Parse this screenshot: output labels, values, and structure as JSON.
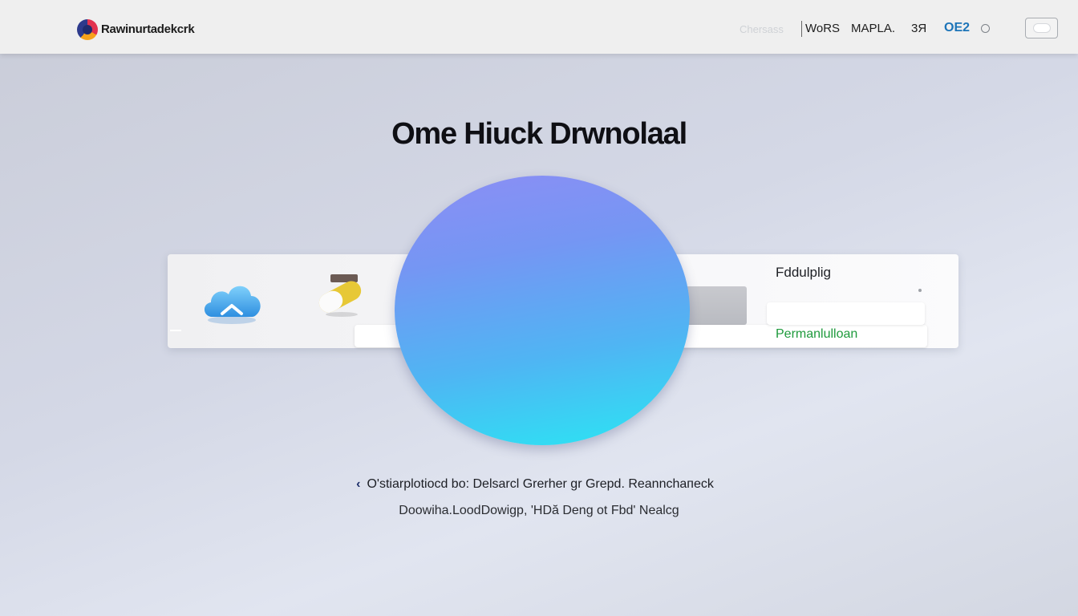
{
  "header": {
    "brand": "Rawinurtadekcrk",
    "nav_faint": "Chersass",
    "nav_items": [
      "WoRS",
      "MAPLA.",
      "3Я"
    ],
    "nav_accent": "OE2"
  },
  "hero": {
    "title": "Ome Hiuck Drwnolaal"
  },
  "panel": {
    "label": "Fddulplig",
    "link": "Permanlulloan"
  },
  "caption": {
    "line1": "O'stiarplotiocd bo: Delsarcl Grerher gr  Grepd. Reannchaпeck",
    "line2": "Doowiha.LoodDowigp, 'HDă Deng  ot  Fbd' Nealcg"
  },
  "colors": {
    "accent": "#1c74b8",
    "link": "#1e9a3c",
    "orb_top": "#8c8ef5",
    "orb_bottom": "#2ae6f3"
  }
}
